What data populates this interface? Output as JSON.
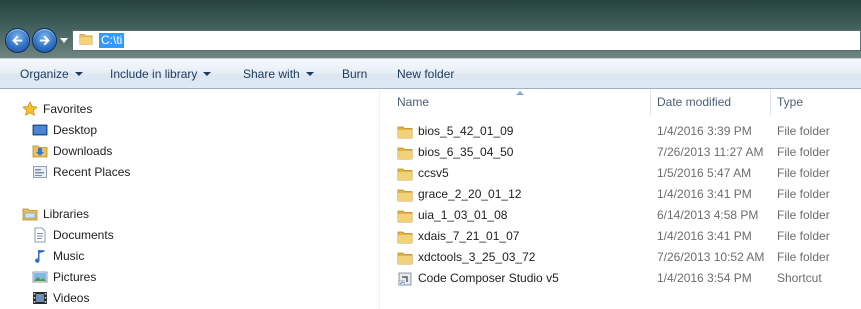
{
  "address": {
    "path": "C:\\ti"
  },
  "toolbar": {
    "organize": "Organize",
    "include_in_library": "Include in library",
    "share_with": "Share with",
    "burn": "Burn",
    "new_folder": "New folder"
  },
  "navpane": {
    "favorites": "Favorites",
    "desktop": "Desktop",
    "downloads": "Downloads",
    "recent_places": "Recent Places",
    "libraries": "Libraries",
    "documents": "Documents",
    "music": "Music",
    "pictures": "Pictures",
    "videos": "Videos"
  },
  "columns": {
    "name": "Name",
    "date_modified": "Date modified",
    "type": "Type"
  },
  "files": [
    {
      "name": "bios_5_42_01_09",
      "date": "1/4/2016 3:39 PM",
      "type": "File folder",
      "icon": "folder-icon"
    },
    {
      "name": "bios_6_35_04_50",
      "date": "7/26/2013 11:27 AM",
      "type": "File folder",
      "icon": "folder-icon"
    },
    {
      "name": "ccsv5",
      "date": "1/5/2016 5:47 AM",
      "type": "File folder",
      "icon": "folder-icon"
    },
    {
      "name": "grace_2_20_01_12",
      "date": "1/4/2016 3:41 PM",
      "type": "File folder",
      "icon": "folder-icon"
    },
    {
      "name": "uia_1_03_01_08",
      "date": "6/14/2013 4:58 PM",
      "type": "File folder",
      "icon": "folder-icon"
    },
    {
      "name": "xdais_7_21_01_07",
      "date": "1/4/2016 3:41 PM",
      "type": "File folder",
      "icon": "folder-icon"
    },
    {
      "name": "xdctools_3_25_03_72",
      "date": "7/26/2013 10:52 AM",
      "type": "File folder",
      "icon": "folder-icon"
    },
    {
      "name": "Code Composer Studio v5",
      "date": "1/4/2016 3:54 PM",
      "type": "Shortcut",
      "icon": "shortcut-icon"
    }
  ]
}
